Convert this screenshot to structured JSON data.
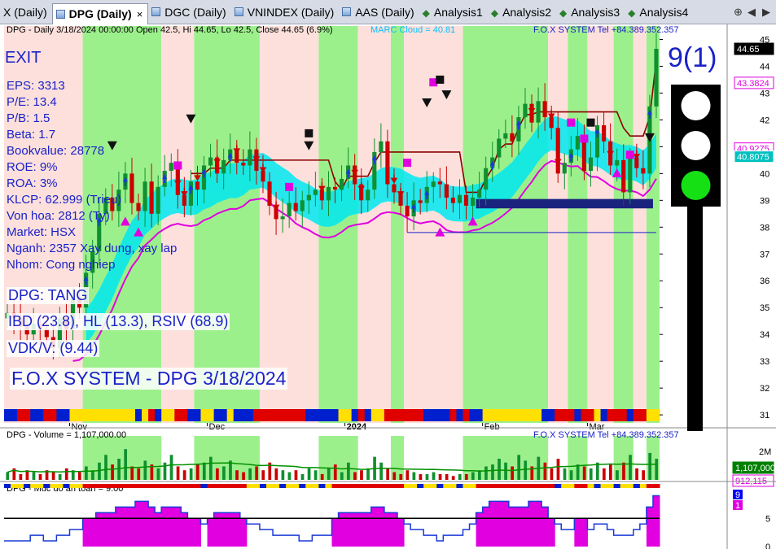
{
  "tabs": [
    {
      "label": "X (Daily)",
      "icon": "chart-icon",
      "active": false
    },
    {
      "label": "DPG (Daily)",
      "icon": "chart-icon",
      "active": true
    },
    {
      "label": "DGC (Daily)",
      "icon": "chart-icon",
      "active": false
    },
    {
      "label": "VNINDEX (Daily)",
      "icon": "chart-icon",
      "active": false
    },
    {
      "label": "AAS (Daily)",
      "icon": "chart-icon",
      "active": false
    },
    {
      "label": "Analysis1",
      "icon": "analysis-icon",
      "active": false
    },
    {
      "label": "Analysis2",
      "icon": "analysis-icon",
      "active": false
    },
    {
      "label": "Analysis3",
      "icon": "analysis-icon",
      "active": false
    },
    {
      "label": "Analysis4",
      "icon": "analysis-icon",
      "active": false
    }
  ],
  "tab_close": "×",
  "nav_icons": {
    "left": "⊕",
    "prev": "◀",
    "next": "▶"
  },
  "price_panel": {
    "header": "DPG - Daily 3/18/2024 00:00:00 Open 42.5, Hi 44.65, Lo 42.5, Close 44.65 (6.9%)",
    "marc_cloud": "MARC Cloud = 40.81",
    "brand": "F.O.X SYSTEM Tel +84.389.352.357",
    "exit_label": "EXIT",
    "fundamentals": [
      "EPS: 3313",
      "P/E: 13.4",
      "P/B: 1.5",
      "Beta: 1.7",
      "Bookvalue: 28778",
      "ROE: 9%",
      "ROA: 3%",
      "KLCP: 62.999 (Trieu)",
      "Von hoa: 2812 (Ty)",
      "Market: HSX",
      "Nganh: 2357 Xay dung, xay lap",
      "Nhom: Cong nghiep"
    ],
    "trend": "DPG: TANG",
    "ibd": "IBD (23.8), HL (13.3), RSIV (68.9)",
    "vdk": "VDK/V:  (9.44)",
    "watermark": "F.O.X SYSTEM - DPG 3/18/2024",
    "signal_count": "9(1)",
    "price_tags": [
      {
        "value": "44.65",
        "bg": "#000000",
        "fg": "#ffffff"
      },
      {
        "value": "43.3824",
        "bg": "#ffffff",
        "fg": "#e000e0"
      },
      {
        "value": "40.9275",
        "bg": "#ffffff",
        "fg": "#e000e0"
      },
      {
        "value": "40.8075",
        "bg": "#00c0c0",
        "fg": "#ffffff"
      }
    ],
    "traffic_light": [
      "white",
      "white",
      "green"
    ]
  },
  "volume_panel": {
    "header": "DPG - Volume = 1,107,000.00",
    "brand": "F.O.X SYSTEM Tel +84.389.352.357",
    "axis_label": "2M",
    "tags": [
      {
        "value": "1,107,000",
        "bg": "#008000",
        "fg": "#ffffff"
      },
      {
        "value": "912,115",
        "bg": "#ffffff",
        "fg": "#e000e0"
      }
    ]
  },
  "safety_panel": {
    "header": "DPG - Muc do an toan = 9.00",
    "tags": [
      {
        "value": "9",
        "bg": "#0000ff",
        "fg": "#ffffff"
      },
      {
        "value": "1",
        "bg": "#e000e0",
        "fg": "#ffffff"
      }
    ]
  },
  "colors": {
    "up": "#109030",
    "down": "#cc0000",
    "green_zone": "#9cf08c",
    "red_zone": "#fde0dc",
    "cloud": "#00e8f0",
    "magenta": "#e000e0",
    "ma_red": "#8b0000",
    "support": "#1a237e"
  },
  "chart_data": {
    "type": "candlestick",
    "symbol": "DPG",
    "ylim": [
      30.7,
      45.5
    ],
    "y_ticks": [
      31,
      32,
      33,
      34,
      35,
      36,
      37,
      38,
      39,
      40,
      41,
      42,
      43,
      44,
      45
    ],
    "x_labels": [
      {
        "i": 10,
        "label": "Nov"
      },
      {
        "i": 31,
        "label": "Dec"
      },
      {
        "i": 52,
        "label": "2024"
      },
      {
        "i": 73,
        "label": "Feb"
      },
      {
        "i": 89,
        "label": "Mar"
      }
    ],
    "n_bars": 100,
    "zones": [
      {
        "from": 0,
        "to": 2,
        "type": "red"
      },
      {
        "from": 2,
        "to": 12,
        "type": "red"
      },
      {
        "from": 12,
        "to": 24,
        "type": "green"
      },
      {
        "from": 24,
        "to": 29,
        "type": "red"
      },
      {
        "from": 29,
        "to": 39,
        "type": "green"
      },
      {
        "from": 39,
        "to": 48,
        "type": "red"
      },
      {
        "from": 48,
        "to": 54,
        "type": "green"
      },
      {
        "from": 54,
        "to": 59,
        "type": "red"
      },
      {
        "from": 59,
        "to": 61,
        "type": "green"
      },
      {
        "from": 61,
        "to": 70,
        "type": "red"
      },
      {
        "from": 70,
        "to": 83,
        "type": "green"
      },
      {
        "from": 83,
        "to": 86,
        "type": "red"
      },
      {
        "from": 86,
        "to": 89,
        "type": "green"
      },
      {
        "from": 89,
        "to": 93,
        "type": "red"
      },
      {
        "from": 93,
        "to": 96,
        "type": "green"
      },
      {
        "from": 96,
        "to": 98,
        "type": "red"
      },
      {
        "from": 98,
        "to": 100,
        "type": "green"
      }
    ],
    "close": [
      34.8,
      34.6,
      34.3,
      34.0,
      34.4,
      34.2,
      33.9,
      33.5,
      34.6,
      34.2,
      35.4,
      35.0,
      36.3,
      37.1,
      38.5,
      39.1,
      38.6,
      39.4,
      40.0,
      38.9,
      38.6,
      39.7,
      38.5,
      39.5,
      40.1,
      40.4,
      39.2,
      38.8,
      39.7,
      39.4,
      40.3,
      40.6,
      40.0,
      40.5,
      40.9,
      40.4,
      40.3,
      40.9,
      40.1,
      39.7,
      38.8,
      38.3,
      38.4,
      38.9,
      38.6,
      39.0,
      39.2,
      39.4,
      39.0,
      39.5,
      39.4,
      39.8,
      40.3,
      39.6,
      39.0,
      39.4,
      40.8,
      41.2,
      39.6,
      39.3,
      38.8,
      38.4,
      39.0,
      38.9,
      39.5,
      39.7,
      39.6,
      39.1,
      38.9,
      39.2,
      38.8,
      39.1,
      39.4,
      40.2,
      40.6,
      41.3,
      41.5,
      41.2,
      42.1,
      42.6,
      41.9,
      42.7,
      42.1,
      41.7,
      40.0,
      40.4,
      40.9,
      41.4,
      40.1,
      40.6,
      41.8,
      41.2,
      40.3,
      40.5,
      39.3,
      40.6,
      40.2,
      40.0,
      42.5,
      44.65
    ],
    "marc_cloud": 40.81,
    "support_line": 38.8
  },
  "volume_data": [
    0.4,
    0.6,
    0.3,
    0.5,
    0.4,
    0.3,
    0.5,
    0.4,
    0.3,
    0.6,
    0.5,
    0.4,
    0.7,
    0.5,
    0.9,
    1.3,
    0.8,
    1.1,
    1.6,
    0.7,
    0.6,
    1.0,
    0.8,
    0.6,
    0.9,
    1.3,
    0.7,
    0.5,
    0.6,
    0.8,
    0.9,
    1.2,
    0.6,
    0.7,
    1.0,
    0.5,
    0.4,
    0.6,
    0.7,
    0.5,
    0.9,
    0.6,
    0.5,
    0.4,
    0.5,
    0.3,
    0.6,
    0.5,
    0.3,
    0.6,
    0.8,
    0.4,
    0.9,
    0.4,
    0.5,
    0.6,
    1.2,
    0.9,
    0.6,
    0.4,
    0.3,
    0.5,
    0.4,
    0.3,
    0.3,
    0.4,
    0.3,
    0.3,
    0.2,
    0.3,
    0.3,
    0.4,
    0.5,
    0.7,
    0.8,
    1.1,
    0.9,
    0.7,
    1.3,
    1.0,
    0.7,
    1.2,
    0.9,
    0.6,
    1.1,
    0.6,
    0.5,
    0.8,
    0.7,
    0.6,
    0.9,
    0.6,
    0.8,
    0.5,
    0.9,
    1.3,
    0.6,
    0.5,
    1.4,
    1.1
  ],
  "safety_data": [
    1,
    1,
    1,
    1,
    2,
    2,
    1,
    1,
    2,
    2,
    3,
    3,
    5,
    5,
    6,
    6,
    6,
    7,
    7,
    7,
    8,
    8,
    7,
    6,
    7,
    7,
    7,
    6,
    5,
    5,
    4,
    5,
    6,
    6,
    6,
    6,
    5,
    4,
    4,
    3,
    3,
    2,
    2,
    2,
    2,
    1,
    1,
    2,
    2,
    2,
    5,
    6,
    6,
    6,
    6,
    6,
    7,
    7,
    6,
    6,
    5,
    4,
    3,
    3,
    2,
    2,
    1,
    2,
    2,
    2,
    3,
    4,
    6,
    7,
    8,
    8,
    8,
    7,
    7,
    7,
    8,
    8,
    7,
    5,
    4,
    3,
    3,
    5,
    5,
    3,
    4,
    4,
    3,
    2,
    2,
    2,
    3,
    4,
    7,
    9
  ]
}
